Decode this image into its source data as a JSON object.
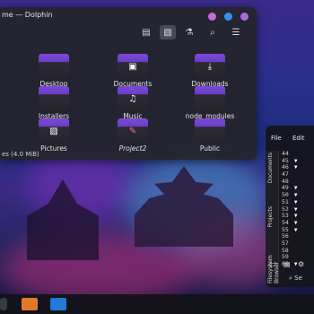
{
  "dolphin": {
    "title": "me — Dolphin",
    "status": "es (4.0 MiB)",
    "items": [
      {
        "label": "Desktop",
        "glyph": ""
      },
      {
        "label": "Documents",
        "glyph": "▣"
      },
      {
        "label": "Downloads",
        "glyph": "⤓"
      },
      {
        "label": "Installers",
        "glyph": ""
      },
      {
        "label": "Music",
        "glyph": "♫"
      },
      {
        "label": "node_modules",
        "glyph": ""
      },
      {
        "label": "Pictures",
        "glyph": "▨"
      },
      {
        "label": "Project2",
        "glyph": "✎"
      },
      {
        "label": "Public",
        "glyph": ""
      }
    ],
    "window_buttons": [
      "#c86ad8",
      "#3a8ff0",
      "#a86ae0"
    ]
  },
  "editor": {
    "menu": [
      "File",
      "Edit"
    ],
    "side_tabs": [
      "Documents",
      "Projects",
      "Filesystem Browser"
    ],
    "line_numbers": [
      "44",
      "45",
      "46",
      "47",
      "48",
      "49",
      "50",
      "51",
      "52",
      "53",
      "54",
      "55",
      "56",
      "57",
      "58",
      "59",
      "60"
    ],
    "search_placeholder": "Se"
  },
  "colors": {
    "folder_accent": "#7b4bd8",
    "window_bg": "#24242c"
  }
}
